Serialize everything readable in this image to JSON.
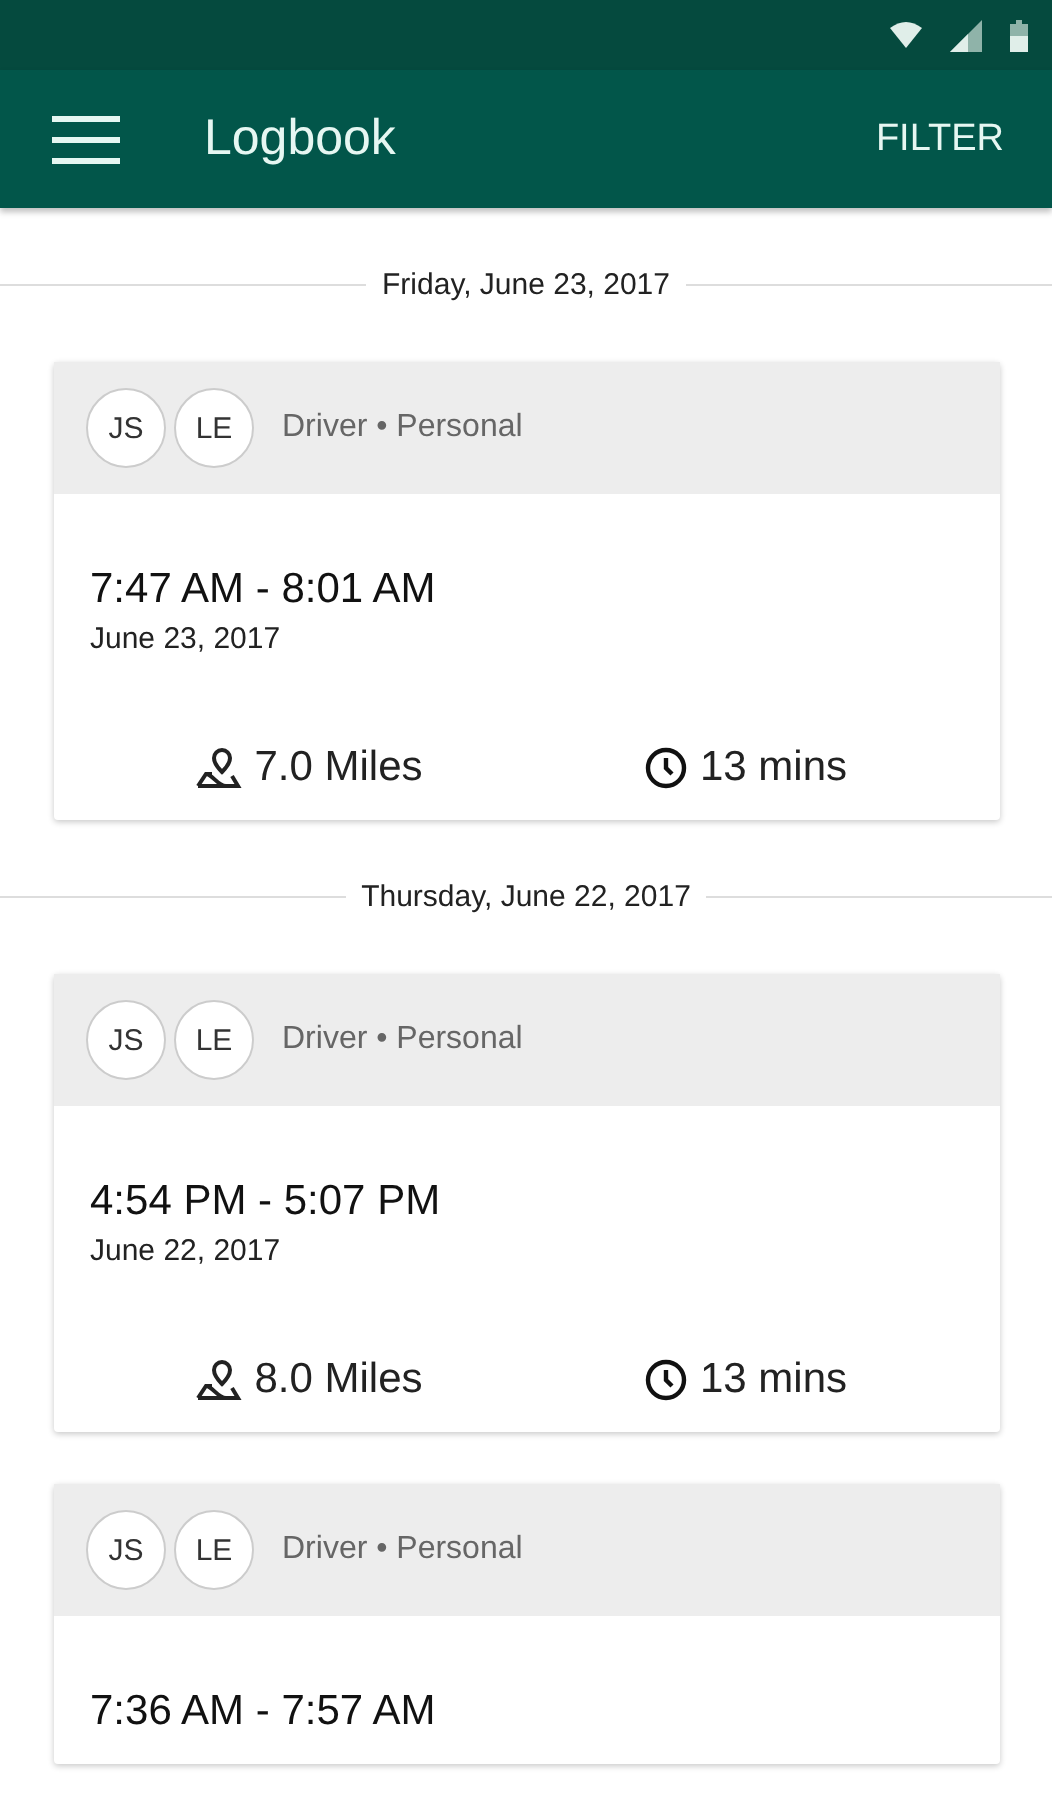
{
  "app_bar": {
    "title": "Logbook",
    "action": "FILTER"
  },
  "days": [
    {
      "date": "Friday, June 23, 2017",
      "trips": [
        {
          "people": [
            "JS",
            "LE"
          ],
          "role": "Driver • Personal",
          "time": "7:47 AM - 8:01 AM",
          "date": "June 23, 2017",
          "distance": "7.0 Miles",
          "duration": "13 mins"
        }
      ]
    },
    {
      "date": "Thursday, June 22, 2017",
      "trips": [
        {
          "people": [
            "JS",
            "LE"
          ],
          "role": "Driver • Personal",
          "time": "4:54 PM - 5:07 PM",
          "date": "June 22, 2017",
          "distance": "8.0 Miles",
          "duration": "13 mins"
        },
        {
          "people": [
            "JS",
            "LE"
          ],
          "role": "Driver • Personal",
          "time": "7:36 AM - 7:57 AM"
        }
      ]
    }
  ]
}
